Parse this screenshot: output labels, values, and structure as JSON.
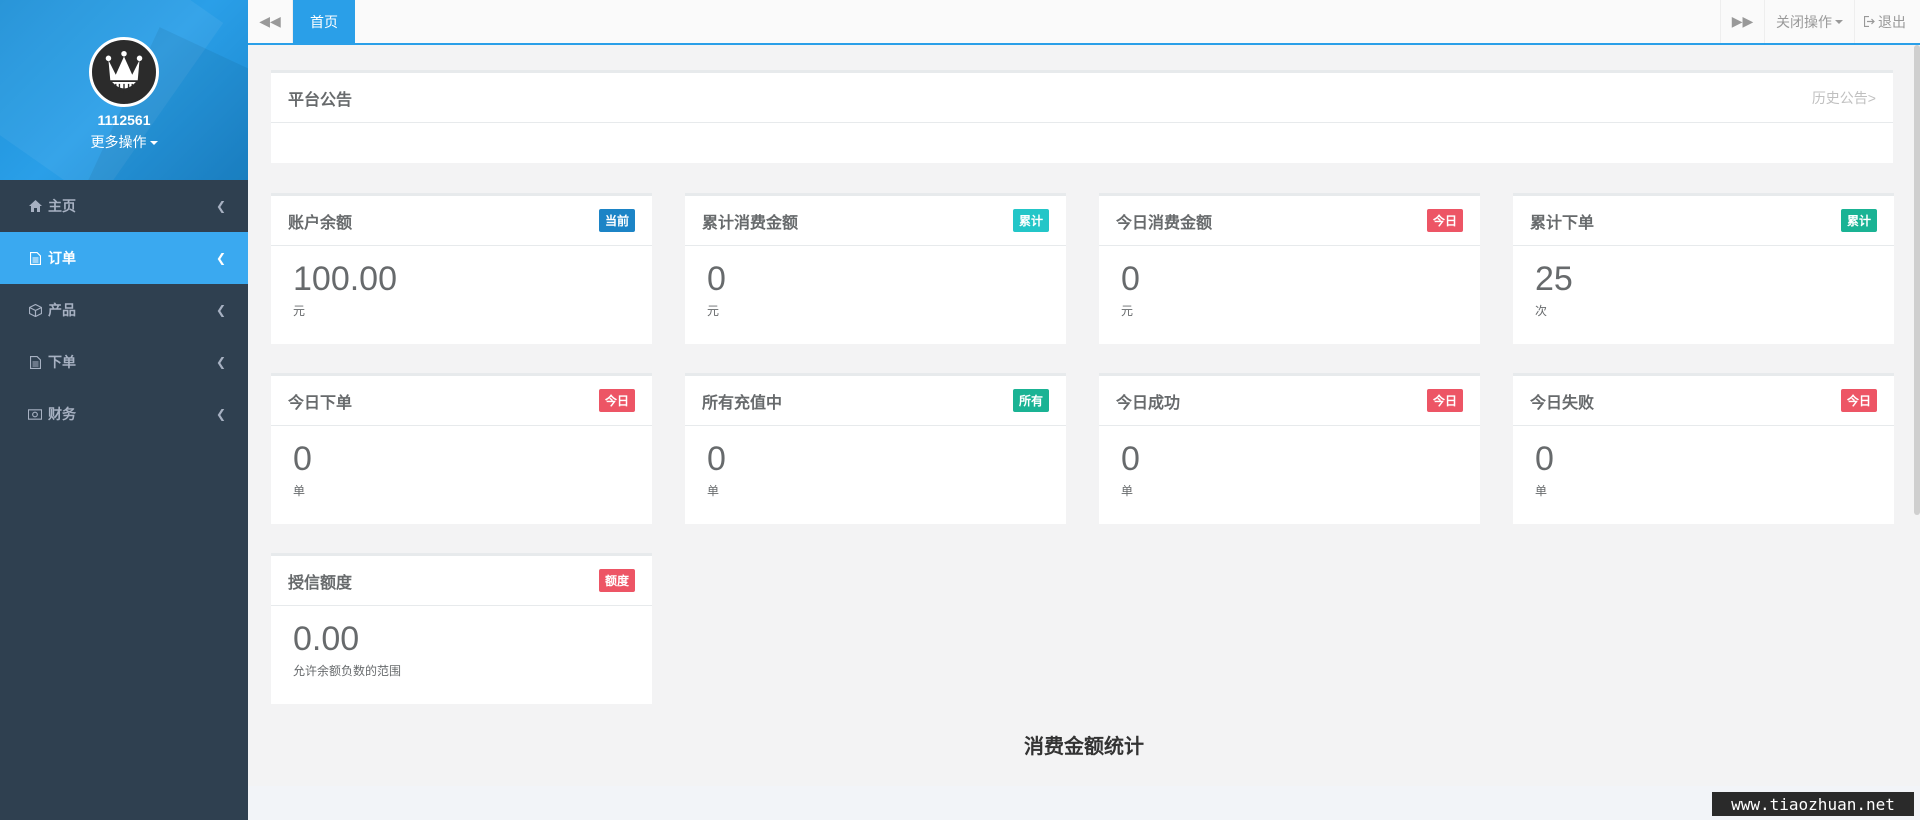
{
  "profile": {
    "username": "1112561",
    "more_ops": "更多操作"
  },
  "nav": [
    {
      "label": "主页",
      "icon": "home-icon",
      "active": false
    },
    {
      "label": "订单",
      "icon": "document-icon",
      "active": true
    },
    {
      "label": "产品",
      "icon": "cube-icon",
      "active": false
    },
    {
      "label": "下单",
      "icon": "file-icon",
      "active": false
    },
    {
      "label": "财务",
      "icon": "money-icon",
      "active": false
    }
  ],
  "topbar": {
    "home_tab": "首页",
    "close_ops": "关闭操作",
    "exit": "退出"
  },
  "announcement": {
    "title": "平台公告",
    "history": "历史公告>"
  },
  "cards": [
    {
      "title": "账户余额",
      "badge": "当前",
      "badge_color": "#1c84c6",
      "value": "100.00",
      "unit": "元"
    },
    {
      "title": "累计消费金额",
      "badge": "累计",
      "badge_color": "#23c6c8",
      "value": "0",
      "unit": "元"
    },
    {
      "title": "今日消费金额",
      "badge": "今日",
      "badge_color": "#ed5565",
      "value": "0",
      "unit": "元"
    },
    {
      "title": "累计下单",
      "badge": "累计",
      "badge_color": "#1ab394",
      "value": "25",
      "unit": "次"
    },
    {
      "title": "今日下单",
      "badge": "今日",
      "badge_color": "#ed5565",
      "value": "0",
      "unit": "单"
    },
    {
      "title": "所有充值中",
      "badge": "所有",
      "badge_color": "#1ab394",
      "value": "0",
      "unit": "单"
    },
    {
      "title": "今日成功",
      "badge": "今日",
      "badge_color": "#ed5565",
      "value": "0",
      "unit": "单"
    },
    {
      "title": "今日失败",
      "badge": "今日",
      "badge_color": "#ed5565",
      "value": "0",
      "unit": "单"
    },
    {
      "title": "授信额度",
      "badge": "额度",
      "badge_color": "#ed5565",
      "value": "0.00",
      "unit": "允许余额负数的范围"
    }
  ],
  "stats_title": "消费金额统计",
  "watermark": "www.tiaozhuan.net"
}
